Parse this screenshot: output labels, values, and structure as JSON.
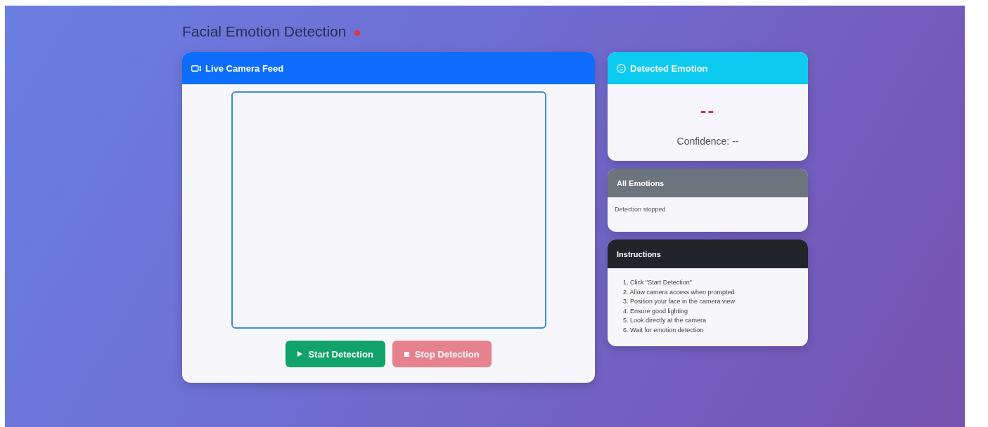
{
  "page": {
    "title": "Facial Emotion Detection"
  },
  "camera": {
    "title": "Live Camera Feed",
    "buttons": [
      {
        "label": "Start Detection",
        "kind": "start",
        "disabled": false
      },
      {
        "label": "Stop Detection",
        "kind": "stop",
        "disabled": true
      }
    ]
  },
  "emotion": {
    "title": "Detected Emotion",
    "value": "--",
    "confidence": "Confidence: --"
  },
  "all_emotions": {
    "title": "All Emotions",
    "status": "Detection stopped"
  },
  "instructions": {
    "title": "Instructions",
    "steps": [
      "1. Click \"Start Detection\"",
      "2. Allow camera access when prompted",
      "3. Position your face in the camera view",
      "4. Ensure good lighting",
      "5. Look directly at the camera",
      "6. Wait for emotion detection"
    ]
  }
}
